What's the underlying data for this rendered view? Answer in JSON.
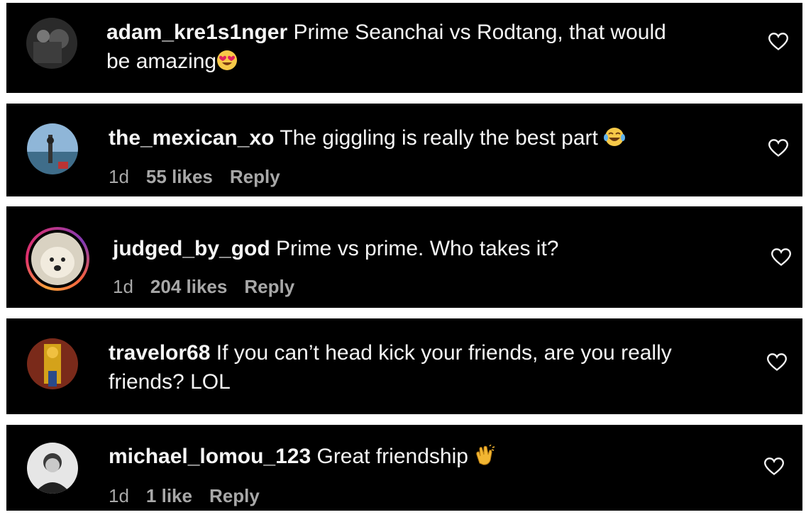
{
  "colors": {
    "card_bg": "#000000",
    "page_bg": "#ffffff",
    "text": "#f5f5f5",
    "meta": "#a8a8a8",
    "story_ring": "#e1306c"
  },
  "comments": [
    {
      "username": "adam_kre1s1nger",
      "text": "Prime Seanchai vs Rodtang, that would",
      "text_line2": "be amazing",
      "emoji": "heart-eyes-emoji"
    },
    {
      "username": "the_mexican_xo",
      "text": "The giggling is really the best part",
      "emoji": "tears-of-joy-emoji",
      "time": "1d",
      "likes": "55 likes",
      "reply": "Reply"
    },
    {
      "username": "judged_by_god",
      "text": "Prime vs prime. Who takes it?",
      "time": "1d",
      "likes": "204 likes",
      "reply": "Reply"
    },
    {
      "username": "travelor68",
      "text": "If you can’t head kick your friends, are you really",
      "text_line2": "friends? LOL"
    },
    {
      "username": "michael_lomou_123",
      "text": "Great friendship",
      "emoji": "clapping-hands-emoji",
      "time": "1d",
      "likes": "1 like",
      "reply": "Reply"
    }
  ]
}
